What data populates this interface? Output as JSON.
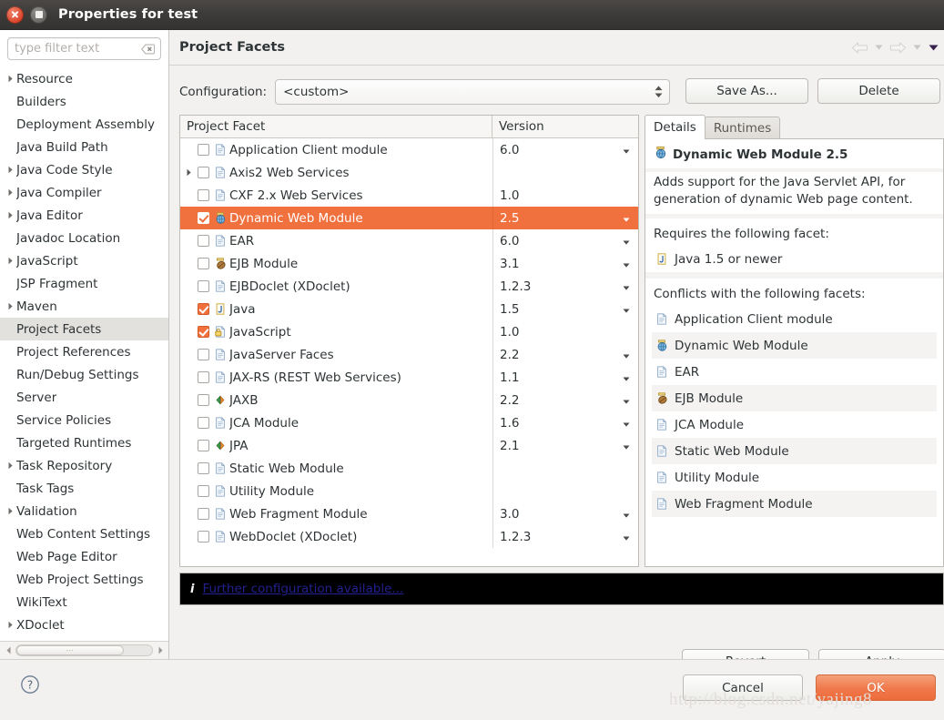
{
  "window": {
    "title": "Properties for test",
    "close_icon": "close-icon",
    "maximize_icon": "maximize-icon"
  },
  "sidebar": {
    "filter": {
      "value": "",
      "placeholder": "type filter text",
      "clear_icon": "clear-icon"
    },
    "items": [
      {
        "label": "Resource",
        "expandable": true,
        "selected": false
      },
      {
        "label": "Builders",
        "expandable": false,
        "selected": false
      },
      {
        "label": "Deployment Assembly",
        "expandable": false,
        "selected": false
      },
      {
        "label": "Java Build Path",
        "expandable": false,
        "selected": false
      },
      {
        "label": "Java Code Style",
        "expandable": true,
        "selected": false
      },
      {
        "label": "Java Compiler",
        "expandable": true,
        "selected": false
      },
      {
        "label": "Java Editor",
        "expandable": true,
        "selected": false
      },
      {
        "label": "Javadoc Location",
        "expandable": false,
        "selected": false
      },
      {
        "label": "JavaScript",
        "expandable": true,
        "selected": false
      },
      {
        "label": "JSP Fragment",
        "expandable": false,
        "selected": false
      },
      {
        "label": "Maven",
        "expandable": true,
        "selected": false
      },
      {
        "label": "Project Facets",
        "expandable": false,
        "selected": true
      },
      {
        "label": "Project References",
        "expandable": false,
        "selected": false
      },
      {
        "label": "Run/Debug Settings",
        "expandable": false,
        "selected": false
      },
      {
        "label": "Server",
        "expandable": false,
        "selected": false
      },
      {
        "label": "Service Policies",
        "expandable": false,
        "selected": false
      },
      {
        "label": "Targeted Runtimes",
        "expandable": false,
        "selected": false
      },
      {
        "label": "Task Repository",
        "expandable": true,
        "selected": false
      },
      {
        "label": "Task Tags",
        "expandable": false,
        "selected": false
      },
      {
        "label": "Validation",
        "expandable": true,
        "selected": false
      },
      {
        "label": "Web Content Settings",
        "expandable": false,
        "selected": false
      },
      {
        "label": "Web Page Editor",
        "expandable": false,
        "selected": false
      },
      {
        "label": "Web Project Settings",
        "expandable": false,
        "selected": false
      },
      {
        "label": "WikiText",
        "expandable": false,
        "selected": false
      },
      {
        "label": "XDoclet",
        "expandable": true,
        "selected": false
      }
    ],
    "scrollbar": {
      "left_arrow_icon": "scroll-left-icon",
      "right_arrow_icon": "scroll-right-icon",
      "grip": "⋯"
    }
  },
  "page": {
    "title": "Project Facets",
    "nav": {
      "back_icon": "back-arrow-icon",
      "back_caret_icon": "chevron-down-icon",
      "forward_icon": "forward-arrow-icon",
      "forward_caret_icon": "chevron-down-icon",
      "menu_caret_icon": "chevron-down-icon"
    }
  },
  "configuration": {
    "label": "Configuration:",
    "value": "<custom>",
    "spinner_icon": "spinner-updown-icon",
    "save_as_label": "Save As...",
    "delete_label": "Delete"
  },
  "facet_table": {
    "columns": [
      "Project Facet",
      "Version"
    ],
    "rows": [
      {
        "name": "Application Client module",
        "version": "6.0",
        "checked": false,
        "selected": false,
        "expandable": false,
        "icon": "doc-icon",
        "has_version_caret": true
      },
      {
        "name": "Axis2 Web Services",
        "version": "",
        "checked": false,
        "selected": false,
        "expandable": true,
        "icon": "doc-icon",
        "has_version_caret": false
      },
      {
        "name": "CXF 2.x Web Services",
        "version": "1.0",
        "checked": false,
        "selected": false,
        "expandable": false,
        "icon": "doc-icon",
        "has_version_caret": false
      },
      {
        "name": "Dynamic Web Module",
        "version": "2.5",
        "checked": true,
        "selected": true,
        "expandable": false,
        "icon": "web-module-icon",
        "has_version_caret": true
      },
      {
        "name": "EAR",
        "version": "6.0",
        "checked": false,
        "selected": false,
        "expandable": false,
        "icon": "doc-icon",
        "has_version_caret": true
      },
      {
        "name": "EJB Module",
        "version": "3.1",
        "checked": false,
        "selected": false,
        "expandable": false,
        "icon": "ejb-module-icon",
        "has_version_caret": true
      },
      {
        "name": "EJBDoclet (XDoclet)",
        "version": "1.2.3",
        "checked": false,
        "selected": false,
        "expandable": false,
        "icon": "doc-icon",
        "has_version_caret": true
      },
      {
        "name": "Java",
        "version": "1.5",
        "checked": true,
        "selected": false,
        "expandable": false,
        "icon": "java-icon",
        "has_version_caret": true
      },
      {
        "name": "JavaScript",
        "version": "1.0",
        "checked": true,
        "selected": false,
        "expandable": false,
        "icon": "javascript-icon",
        "has_version_caret": false
      },
      {
        "name": "JavaServer Faces",
        "version": "2.2",
        "checked": false,
        "selected": false,
        "expandable": false,
        "icon": "doc-icon",
        "has_version_caret": true
      },
      {
        "name": "JAX-RS (REST Web Services)",
        "version": "1.1",
        "checked": false,
        "selected": false,
        "expandable": false,
        "icon": "doc-icon",
        "has_version_caret": true
      },
      {
        "name": "JAXB",
        "version": "2.2",
        "checked": false,
        "selected": false,
        "expandable": false,
        "icon": "jaxb-icon",
        "has_version_caret": true
      },
      {
        "name": "JCA Module",
        "version": "1.6",
        "checked": false,
        "selected": false,
        "expandable": false,
        "icon": "doc-icon",
        "has_version_caret": true
      },
      {
        "name": "JPA",
        "version": "2.1",
        "checked": false,
        "selected": false,
        "expandable": false,
        "icon": "jpa-icon",
        "has_version_caret": true
      },
      {
        "name": "Static Web Module",
        "version": "",
        "checked": false,
        "selected": false,
        "expandable": false,
        "icon": "doc-icon",
        "has_version_caret": false
      },
      {
        "name": "Utility Module",
        "version": "",
        "checked": false,
        "selected": false,
        "expandable": false,
        "icon": "doc-icon",
        "has_version_caret": false
      },
      {
        "name": "Web Fragment Module",
        "version": "3.0",
        "checked": false,
        "selected": false,
        "expandable": false,
        "icon": "doc-icon",
        "has_version_caret": true
      },
      {
        "name": "WebDoclet (XDoclet)",
        "version": "1.2.3",
        "checked": false,
        "selected": false,
        "expandable": false,
        "icon": "doc-icon",
        "has_version_caret": true
      }
    ]
  },
  "details": {
    "tabs": [
      {
        "label": "Details",
        "active": true
      },
      {
        "label": "Runtimes",
        "active": false
      }
    ],
    "heading": "Dynamic Web Module 2.5",
    "heading_icon": "web-module-icon",
    "description": "Adds support for the Java Servlet API, for generation of dynamic Web page content.",
    "requires_label": "Requires the following facet:",
    "requires": [
      {
        "label": "Java 1.5 or newer",
        "icon": "java-icon"
      }
    ],
    "conflicts_label": "Conflicts with the following facets:",
    "conflicts": [
      {
        "label": "Application Client module",
        "icon": "doc-icon"
      },
      {
        "label": "Dynamic Web Module",
        "icon": "web-module-icon"
      },
      {
        "label": "EAR",
        "icon": "doc-icon"
      },
      {
        "label": "EJB Module",
        "icon": "ejb-module-icon"
      },
      {
        "label": "JCA Module",
        "icon": "doc-icon"
      },
      {
        "label": "Static Web Module",
        "icon": "doc-icon"
      },
      {
        "label": "Utility Module",
        "icon": "doc-icon"
      },
      {
        "label": "Web Fragment Module",
        "icon": "doc-icon"
      }
    ]
  },
  "info_bar": {
    "icon": "info-icon",
    "icon_glyph": "i",
    "link_text": "Further configuration available..."
  },
  "action_buttons": {
    "revert": "Revert",
    "apply": "Apply",
    "cancel": "Cancel",
    "ok": "OK",
    "help_icon": "help-icon"
  },
  "watermark": "http://blog.csdn.net/yajing8",
  "colors": {
    "selection_orange": "#f0703e",
    "ok_button_orange": "#ee6c3c",
    "titlebar_dark": "#3c3b39",
    "link_blue": "#22208e"
  }
}
